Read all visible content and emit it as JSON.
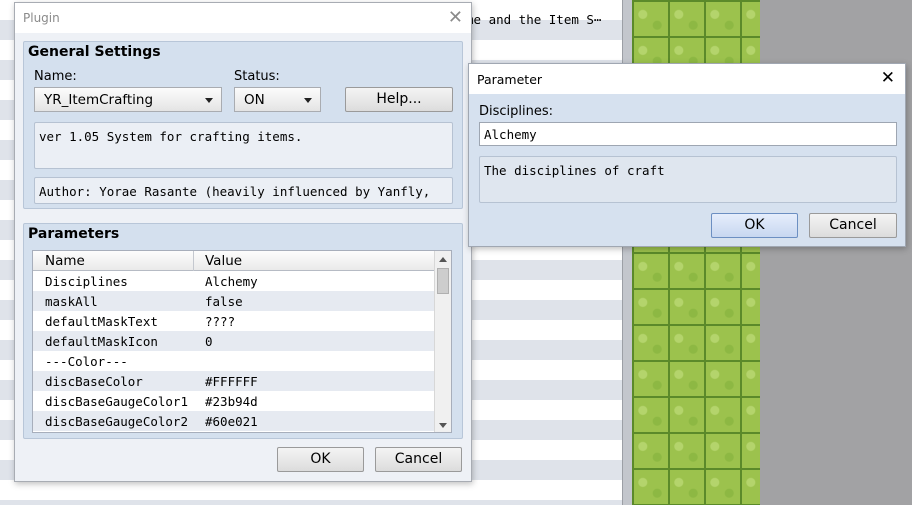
{
  "background": {
    "top_text": "me and the Item S⋯",
    "top_clipped_text": "ver 1.05 System for crafting items"
  },
  "plugin_dialog": {
    "title": "Plugin",
    "general": {
      "title": "General Settings",
      "name_label": "Name:",
      "name_value": "YR_ItemCrafting",
      "status_label": "Status:",
      "status_value": "ON",
      "help_label": "Help...",
      "description": "ver 1.05 System for crafting items.",
      "author": "Author: Yorae Rasante (heavily influenced by Yanfly,"
    },
    "parameters": {
      "title": "Parameters",
      "columns": [
        "Name",
        "Value"
      ],
      "rows": [
        {
          "name": "Disciplines",
          "value": "Alchemy"
        },
        {
          "name": "maskAll",
          "value": "false"
        },
        {
          "name": "defaultMaskText",
          "value": "????"
        },
        {
          "name": "defaultMaskIcon",
          "value": "0"
        },
        {
          "name": "---Color---",
          "value": ""
        },
        {
          "name": "discBaseColor",
          "value": "#FFFFFF"
        },
        {
          "name": "discBaseGaugeColor1",
          "value": "#23b94d"
        },
        {
          "name": "discBaseGaugeColor2",
          "value": "#60e021"
        }
      ]
    },
    "ok_label": "OK",
    "cancel_label": "Cancel"
  },
  "parameter_dialog": {
    "title": "Parameter",
    "field_label": "Disciplines:",
    "field_value": "Alchemy",
    "description": "The disciplines of craft",
    "ok_label": "OK",
    "cancel_label": "Cancel"
  },
  "colors": {
    "dialog_group": "#d4e0ee",
    "row_alt": "#e6eaf1",
    "tile_green": "#9cc24d"
  }
}
